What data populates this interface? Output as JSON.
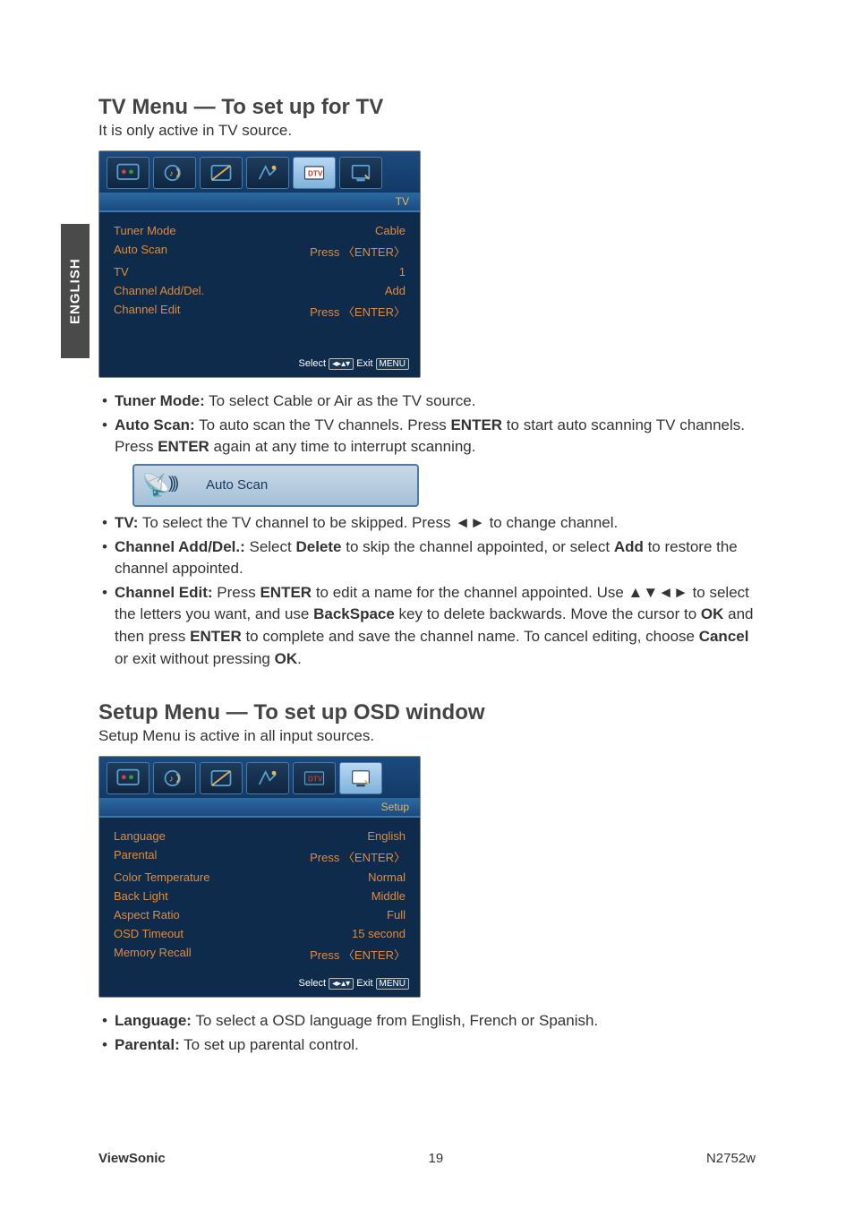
{
  "side_tab": "ENGLISH",
  "section1": {
    "heading": "TV Menu — To set up for TV",
    "sub": "It is only active in TV source."
  },
  "osd1": {
    "title": "TV",
    "rows": [
      {
        "label": "Tuner Mode",
        "value": "Cable"
      },
      {
        "label": "Auto Scan",
        "value": "Press 〈ENTER〉"
      },
      {
        "label": "TV",
        "value": "1"
      },
      {
        "label": "Channel Add/Del.",
        "value": "Add"
      },
      {
        "label": "Channel Edit",
        "value": "Press 〈ENTER〉"
      }
    ],
    "foot_select": "Select",
    "foot_exit": "Exit",
    "foot_menu": "MENU"
  },
  "bullets1": {
    "b1_label": "Tuner Mode:",
    "b1_text": " To select Cable or Air as the TV source.",
    "b2_label": "Auto Scan:",
    "b2_text_a": " To auto scan the TV channels. Press ",
    "b2_enter1": "ENTER",
    "b2_text_b": " to start auto scanning TV channels. Press ",
    "b2_enter2": "ENTER",
    "b2_text_c": " again at any time to interrupt scanning.",
    "scan_label": "Auto Scan",
    "b3_label": "TV:",
    "b3_text": " To select the TV channel to be skipped. Press ◄► to change channel.",
    "b4_label": "Channel Add/Del.:",
    "b4_text_a": " Select ",
    "b4_del": "Delete",
    "b4_text_b": " to skip the channel appointed, or select ",
    "b4_add": "Add",
    "b4_text_c": " to restore the channel appointed.",
    "b5_label": "Channel Edit:",
    "b5_text_a": " Press ",
    "b5_enter1": "ENTER",
    "b5_text_b": " to edit a name for the channel appointed. Use ▲▼◄► to select the letters you want, and use ",
    "b5_bs": "BackSpace",
    "b5_text_c": " key to delete backwards. Move the cursor to ",
    "b5_ok1": "OK",
    "b5_text_d": " and then press ",
    "b5_enter2": "ENTER",
    "b5_text_e": " to complete and save the channel name. To cancel editing, choose ",
    "b5_cancel": "Cancel",
    "b5_text_f": " or exit without pressing ",
    "b5_ok2": "OK",
    "b5_text_g": "."
  },
  "section2": {
    "heading": "Setup Menu — To set up OSD window",
    "sub": "Setup Menu is active in all input sources."
  },
  "osd2": {
    "title": "Setup",
    "rows": [
      {
        "label": "Language",
        "value": "English"
      },
      {
        "label": "Parental",
        "value": "Press 〈ENTER〉"
      },
      {
        "label": "Color Temperature",
        "value": "Normal"
      },
      {
        "label": "Back Light",
        "value": "Middle"
      },
      {
        "label": "Aspect Ratio",
        "value": "Full"
      },
      {
        "label": "OSD Timeout",
        "value": "15 second"
      },
      {
        "label": "Memory Recall",
        "value": "Press 〈ENTER〉"
      }
    ],
    "foot_select": "Select",
    "foot_exit": "Exit",
    "foot_menu": "MENU"
  },
  "bullets2": {
    "b1_label": "Language:",
    "b1_text": " To select a OSD language from English, French or Spanish.",
    "b2_label": "Parental:",
    "b2_text": " To set up parental control."
  },
  "footer": {
    "brand": "ViewSonic",
    "page": "19",
    "model": "N2752w"
  }
}
